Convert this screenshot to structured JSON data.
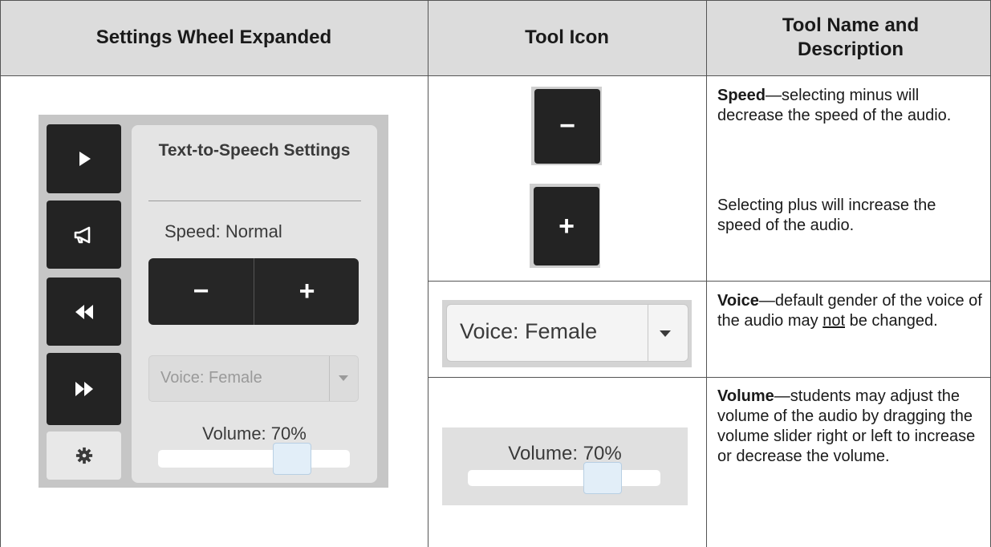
{
  "table": {
    "headers": [
      "Settings Wheel Expanded",
      "Tool Icon",
      "Tool Name and Description"
    ]
  },
  "panel": {
    "side_buttons": [
      {
        "icon": "play-icon"
      },
      {
        "icon": "megaphone-icon"
      },
      {
        "icon": "rewind-icon"
      },
      {
        "icon": "fast-forward-icon"
      },
      {
        "icon": "gear-icon"
      }
    ],
    "title": "Text-to-Speech Settings",
    "speed_label": "Speed: Normal",
    "minus_label": "−",
    "plus_label": "+",
    "voice_value": "Voice: Female",
    "volume_label": "Volume: 70%",
    "volume_level": 0.7
  },
  "icons": {
    "minus_label": "−",
    "plus_label": "+",
    "voice_value": "Voice: Female",
    "volume_label": "Volume: 70%",
    "volume_level": 0.7
  },
  "descriptions": {
    "speed_name": "Speed",
    "speed_text": "—selecting minus will decrease the speed of the audio.",
    "speed_text2": "Selecting plus will increase the speed of the audio.",
    "voice_name": "Voice",
    "voice_text_a": "—default gender of the voice of the audio may ",
    "voice_text_not": "not",
    "voice_text_b": " be changed.",
    "volume_name": "Volume",
    "volume_text": "—students may adjust the volume of the audio by dragging the volume slider right or left to increase or decrease the volume."
  },
  "colors": {
    "header_bg": "#dcdcdc",
    "button_dark": "#232323",
    "slider_thumb": "#e2eef8"
  }
}
